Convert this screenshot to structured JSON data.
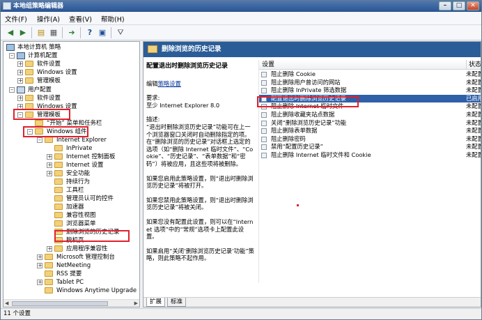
{
  "window": {
    "title": "本地组策略编辑器",
    "min": "–",
    "max": "□",
    "close": "✕"
  },
  "menu": [
    "文件(F)",
    "操作(A)",
    "查看(V)",
    "帮助(H)"
  ],
  "tree": {
    "root": "本地计算机 策略",
    "computer": "计算机配置",
    "c_software": "软件设置",
    "c_windows": "Windows 设置",
    "c_admin": "管理模板",
    "user": "用户配置",
    "u_software": "软件设置",
    "u_windows": "Windows 设置",
    "u_admin": "管理模板",
    "start_menu": "“开始” 菜单和任务栏",
    "win_components": "Windows 组件",
    "ie": "Internet Explorer",
    "inprivate": "InPrivate",
    "ie_cp": "Internet 控制面板",
    "ie_settings": "Internet 设置",
    "security": "安全功能",
    "persistence": "持续行为",
    "toolbars": "工具栏",
    "admin_controls": "管理员认可的控件",
    "accelerators": "加速器",
    "compat_view": "兼容性视图",
    "browser_menu": "浏览器菜单",
    "delete_history": "删除浏览的历史记录",
    "rss_sidebar": "脱机页",
    "app_compat": "应用程序兼容性",
    "mmc": "Microsoft 管理控制台",
    "netmeeting": "NetMeeting",
    "rss": "RSS 提要",
    "tablet": "Tablet PC",
    "wat": "Windows Anytime Upgrade"
  },
  "panel": {
    "header": "删除浏览的历史记录",
    "desc_title": "配置退出时删除浏览历史记录",
    "edit_prefix": "编辑",
    "edit_link": "策略设置",
    "req_label": "要求:",
    "req_value": "至少 Internet Explorer 8.0",
    "desc_label": "描述:",
    "desc_body": "“退出时删除浏览历史记录”功能可在上一个浏览器窗口关闭时自动删除指定的项。在“删除浏览的历史记录”对话框上选定的选项（如“删除 Internet 临时文件”、“Cookie”、“历史记录”、“表单数据”和“密码”）将被应用，且这些项将被删除。",
    "desc_enabled": "如果您启用此策略设置，则“退出时删除浏览历史记录”将被打开。",
    "desc_disabled": "如果您禁用此策略设置，则“退出时删除浏览历史记录”将被关闭。",
    "desc_notconf": "如果您没有配置此设置，则可以在“Internet 选项”中的“常规”选项卡上配置此设置。",
    "desc_extra": "如果启用“关闭‘删除浏览历史记录’功能”策略，则此策略不起作用。",
    "col_setting": "设置",
    "col_state": "状态",
    "rows": [
      {
        "name": "阻止删除 Cookie",
        "state": "未配置"
      },
      {
        "name": "阻止删除用户曾访问的网站",
        "state": "未配置"
      },
      {
        "name": "阻止删除 InPrivate 筛选数据",
        "state": "未配置"
      },
      {
        "name": "配置退出时删除浏览历史记录",
        "state": "已启用"
      },
      {
        "name": "阻止删除 Internet 临时文件",
        "state": "未配置"
      },
      {
        "name": "阻止删除收藏夹站点数据",
        "state": "未配置"
      },
      {
        "name": "关闭“删除浏览历史记录”功能",
        "state": "未配置"
      },
      {
        "name": "阻止删除表单数据",
        "state": "未配置"
      },
      {
        "name": "阻止删除密码",
        "state": "未配置"
      },
      {
        "name": "禁用“配置历史记录”",
        "state": "未配置"
      },
      {
        "name": "阻止删除 Internet 临时文件和 Cookie",
        "state": "未配置"
      }
    ],
    "tab_extended": "扩展",
    "tab_standard": "标准"
  },
  "status": "11 个设置"
}
